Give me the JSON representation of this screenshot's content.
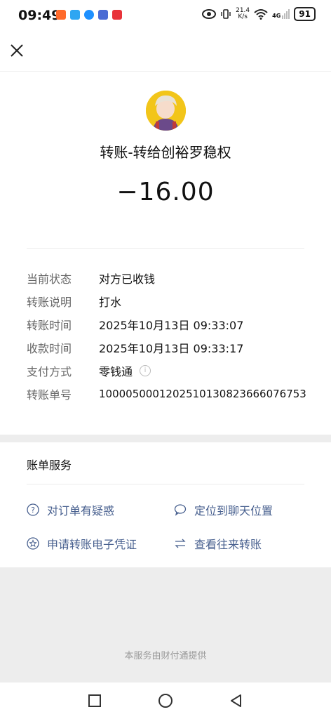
{
  "status_bar": {
    "time": "09:49",
    "net_speed_value": "21.4",
    "net_speed_unit": "K/s",
    "network": "4G",
    "battery": "91"
  },
  "header": {
    "payee_title": "转账-转给创裕罗稳权",
    "amount": "−16.00"
  },
  "details": [
    {
      "label": "当前状态",
      "value": "对方已收钱"
    },
    {
      "label": "转账说明",
      "value": "打水"
    },
    {
      "label": "转账时间",
      "value": "2025年10月13日 09:33:07"
    },
    {
      "label": "收款时间",
      "value": "2025年10月13日 09:33:17"
    },
    {
      "label": "支付方式",
      "value": "零钱通"
    },
    {
      "label": "转账单号",
      "value": "1000050001202510130823666076753"
    }
  ],
  "services": {
    "title": "账单服务",
    "items": [
      {
        "label": "对订单有疑惑",
        "icon": "question-icon"
      },
      {
        "label": "定位到聊天位置",
        "icon": "chat-bubble-icon"
      },
      {
        "label": "申请转账电子凭证",
        "icon": "star-badge-icon"
      },
      {
        "label": "查看往来转账",
        "icon": "transfer-arrows-icon"
      }
    ]
  },
  "footer": {
    "text": "本服务由财付通提供"
  },
  "colors": {
    "link": "#48608f",
    "page_gray": "#ededed"
  }
}
